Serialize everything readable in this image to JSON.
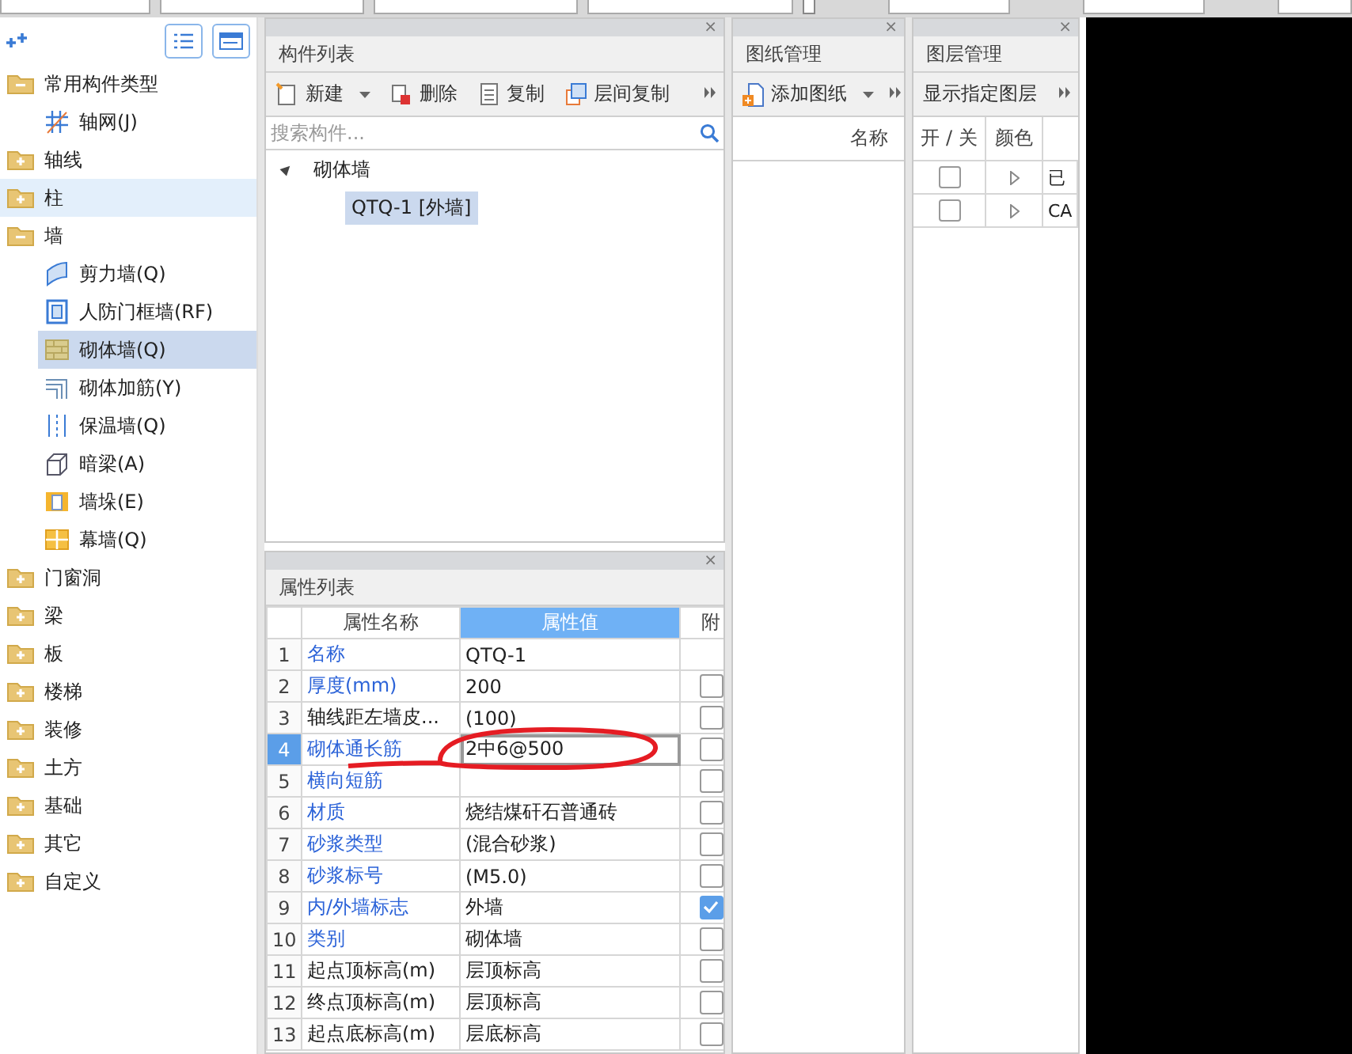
{
  "top_bar": {
    "checkbox": {
      "checked": false
    }
  },
  "sidebar": {
    "items": [
      {
        "label": "常用构件类型",
        "kind": "folder",
        "expanded": true,
        "highlighted": false,
        "children": [
          {
            "label": "轴网(J)",
            "kind": "leaf",
            "selected": false
          }
        ]
      },
      {
        "label": "轴线",
        "kind": "folder",
        "expanded": false,
        "highlighted": false
      },
      {
        "label": "柱",
        "kind": "folder",
        "expanded": false,
        "highlighted": true
      },
      {
        "label": "墙",
        "kind": "folder",
        "expanded": true,
        "highlighted": false,
        "children": [
          {
            "label": "剪力墙(Q)",
            "kind": "leaf",
            "selected": false
          },
          {
            "label": "人防门框墙(RF)",
            "kind": "leaf",
            "selected": false
          },
          {
            "label": "砌体墙(Q)",
            "kind": "leaf",
            "selected": true
          },
          {
            "label": "砌体加筋(Y)",
            "kind": "leaf",
            "selected": false
          },
          {
            "label": "保温墙(Q)",
            "kind": "leaf",
            "selected": false
          },
          {
            "label": "暗梁(A)",
            "kind": "leaf",
            "selected": false
          },
          {
            "label": "墙垛(E)",
            "kind": "leaf",
            "selected": false
          },
          {
            "label": "幕墙(Q)",
            "kind": "leaf",
            "selected": false
          }
        ]
      },
      {
        "label": "门窗洞",
        "kind": "folder",
        "expanded": false,
        "highlighted": false
      },
      {
        "label": "梁",
        "kind": "folder",
        "expanded": false,
        "highlighted": false
      },
      {
        "label": "板",
        "kind": "folder",
        "expanded": false,
        "highlighted": false
      },
      {
        "label": "楼梯",
        "kind": "folder",
        "expanded": false,
        "highlighted": false
      },
      {
        "label": "装修",
        "kind": "folder",
        "expanded": false,
        "highlighted": false
      },
      {
        "label": "土方",
        "kind": "folder",
        "expanded": false,
        "highlighted": false
      },
      {
        "label": "基础",
        "kind": "folder",
        "expanded": false,
        "highlighted": false
      },
      {
        "label": "其它",
        "kind": "folder",
        "expanded": false,
        "highlighted": false
      },
      {
        "label": "自定义",
        "kind": "folder",
        "expanded": false,
        "highlighted": false
      }
    ]
  },
  "component_list": {
    "title": "构件列表",
    "close": "×",
    "toolbar": [
      {
        "label": "新建",
        "dropdown": true
      },
      {
        "label": "删除",
        "dropdown": false
      },
      {
        "label": "复制",
        "dropdown": false
      },
      {
        "label": "层间复制",
        "dropdown": false
      }
    ],
    "search": {
      "placeholder": "搜索构件..."
    },
    "tree": [
      {
        "label": "砌体墙",
        "expanded": true,
        "children": [
          {
            "label": "QTQ-1 [外墙]",
            "selected": true
          }
        ]
      }
    ]
  },
  "properties": {
    "title": "属性列表",
    "close": "×",
    "columns": [
      "属性名称",
      "属性值",
      "附"
    ],
    "rows": [
      {
        "no": "1",
        "name": "名称",
        "value": "QTQ-1",
        "link": true,
        "kind": "plain",
        "selected": false
      },
      {
        "no": "2",
        "name": "厚度(mm)",
        "value": "200",
        "link": true,
        "kind": "check",
        "checked": false,
        "selected": false
      },
      {
        "no": "3",
        "name": "轴线距左墙皮...",
        "value": "(100)",
        "link": false,
        "kind": "check",
        "checked": false,
        "selected": false
      },
      {
        "no": "4",
        "name": "砌体通长筋",
        "value": "2中6@500",
        "link": true,
        "kind": "check",
        "checked": false,
        "selected": true
      },
      {
        "no": "5",
        "name": "横向短筋",
        "value": "",
        "link": true,
        "kind": "check",
        "checked": false,
        "selected": false
      },
      {
        "no": "6",
        "name": "材质",
        "value": "烧结煤矸石普通砖",
        "link": true,
        "kind": "check",
        "checked": false,
        "selected": false
      },
      {
        "no": "7",
        "name": "砂浆类型",
        "value": "(混合砂浆)",
        "link": true,
        "kind": "check",
        "checked": false,
        "selected": false
      },
      {
        "no": "8",
        "name": "砂浆标号",
        "value": "(M5.0)",
        "link": true,
        "kind": "check",
        "checked": false,
        "selected": false
      },
      {
        "no": "9",
        "name": "内/外墙标志",
        "value": "外墙",
        "link": true,
        "kind": "check",
        "checked": true,
        "selected": false
      },
      {
        "no": "10",
        "name": "类别",
        "value": "砌体墙",
        "link": true,
        "kind": "check",
        "checked": false,
        "selected": false
      },
      {
        "no": "11",
        "name": "起点顶标高(m)",
        "value": "层顶标高",
        "link": false,
        "kind": "check",
        "checked": false,
        "selected": false
      },
      {
        "no": "12",
        "name": "终点顶标高(m)",
        "value": "层顶标高",
        "link": false,
        "kind": "check",
        "checked": false,
        "selected": false
      },
      {
        "no": "13",
        "name": "起点底标高(m)",
        "value": "层底标高",
        "link": false,
        "kind": "check",
        "checked": false,
        "selected": false
      }
    ]
  },
  "drawings": {
    "title": "图纸管理",
    "close": "×",
    "toolbar": [
      {
        "label": "添加图纸",
        "dropdown": true
      }
    ],
    "columns": [
      "名称"
    ]
  },
  "layers": {
    "title": "图层管理",
    "close": "×",
    "toolbar": [
      {
        "label": "显示指定图层",
        "dropdown": false
      }
    ],
    "columns": [
      "开 / 关",
      "颜色"
    ],
    "rows": [
      {
        "on": false,
        "name": "已"
      },
      {
        "on": false,
        "name": "CA"
      }
    ]
  }
}
